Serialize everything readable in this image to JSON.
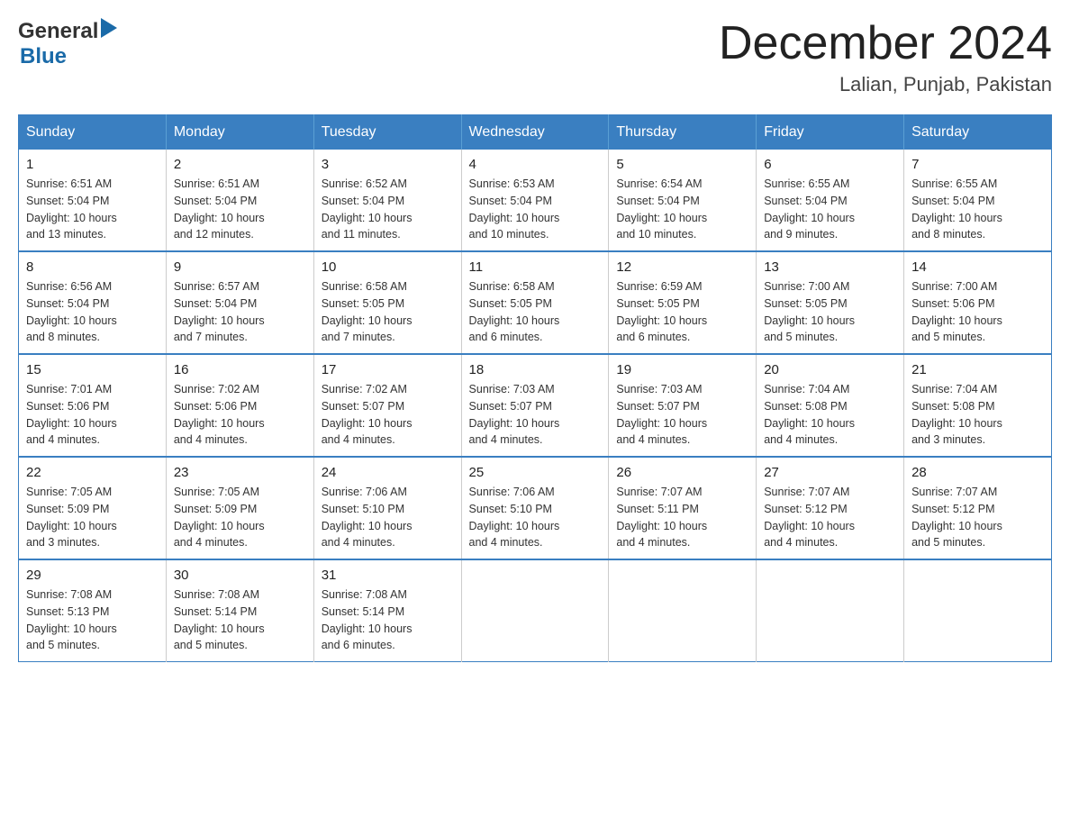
{
  "header": {
    "main_title": "December 2024",
    "subtitle": "Lalian, Punjab, Pakistan",
    "logo_general": "General",
    "logo_blue": "Blue"
  },
  "calendar": {
    "days_of_week": [
      "Sunday",
      "Monday",
      "Tuesday",
      "Wednesday",
      "Thursday",
      "Friday",
      "Saturday"
    ],
    "weeks": [
      [
        {
          "day": "1",
          "sunrise": "6:51 AM",
          "sunset": "5:04 PM",
          "daylight": "10 hours and 13 minutes."
        },
        {
          "day": "2",
          "sunrise": "6:51 AM",
          "sunset": "5:04 PM",
          "daylight": "10 hours and 12 minutes."
        },
        {
          "day": "3",
          "sunrise": "6:52 AM",
          "sunset": "5:04 PM",
          "daylight": "10 hours and 11 minutes."
        },
        {
          "day": "4",
          "sunrise": "6:53 AM",
          "sunset": "5:04 PM",
          "daylight": "10 hours and 10 minutes."
        },
        {
          "day": "5",
          "sunrise": "6:54 AM",
          "sunset": "5:04 PM",
          "daylight": "10 hours and 10 minutes."
        },
        {
          "day": "6",
          "sunrise": "6:55 AM",
          "sunset": "5:04 PM",
          "daylight": "10 hours and 9 minutes."
        },
        {
          "day": "7",
          "sunrise": "6:55 AM",
          "sunset": "5:04 PM",
          "daylight": "10 hours and 8 minutes."
        }
      ],
      [
        {
          "day": "8",
          "sunrise": "6:56 AM",
          "sunset": "5:04 PM",
          "daylight": "10 hours and 8 minutes."
        },
        {
          "day": "9",
          "sunrise": "6:57 AM",
          "sunset": "5:04 PM",
          "daylight": "10 hours and 7 minutes."
        },
        {
          "day": "10",
          "sunrise": "6:58 AM",
          "sunset": "5:05 PM",
          "daylight": "10 hours and 7 minutes."
        },
        {
          "day": "11",
          "sunrise": "6:58 AM",
          "sunset": "5:05 PM",
          "daylight": "10 hours and 6 minutes."
        },
        {
          "day": "12",
          "sunrise": "6:59 AM",
          "sunset": "5:05 PM",
          "daylight": "10 hours and 6 minutes."
        },
        {
          "day": "13",
          "sunrise": "7:00 AM",
          "sunset": "5:05 PM",
          "daylight": "10 hours and 5 minutes."
        },
        {
          "day": "14",
          "sunrise": "7:00 AM",
          "sunset": "5:06 PM",
          "daylight": "10 hours and 5 minutes."
        }
      ],
      [
        {
          "day": "15",
          "sunrise": "7:01 AM",
          "sunset": "5:06 PM",
          "daylight": "10 hours and 4 minutes."
        },
        {
          "day": "16",
          "sunrise": "7:02 AM",
          "sunset": "5:06 PM",
          "daylight": "10 hours and 4 minutes."
        },
        {
          "day": "17",
          "sunrise": "7:02 AM",
          "sunset": "5:07 PM",
          "daylight": "10 hours and 4 minutes."
        },
        {
          "day": "18",
          "sunrise": "7:03 AM",
          "sunset": "5:07 PM",
          "daylight": "10 hours and 4 minutes."
        },
        {
          "day": "19",
          "sunrise": "7:03 AM",
          "sunset": "5:07 PM",
          "daylight": "10 hours and 4 minutes."
        },
        {
          "day": "20",
          "sunrise": "7:04 AM",
          "sunset": "5:08 PM",
          "daylight": "10 hours and 4 minutes."
        },
        {
          "day": "21",
          "sunrise": "7:04 AM",
          "sunset": "5:08 PM",
          "daylight": "10 hours and 3 minutes."
        }
      ],
      [
        {
          "day": "22",
          "sunrise": "7:05 AM",
          "sunset": "5:09 PM",
          "daylight": "10 hours and 3 minutes."
        },
        {
          "day": "23",
          "sunrise": "7:05 AM",
          "sunset": "5:09 PM",
          "daylight": "10 hours and 4 minutes."
        },
        {
          "day": "24",
          "sunrise": "7:06 AM",
          "sunset": "5:10 PM",
          "daylight": "10 hours and 4 minutes."
        },
        {
          "day": "25",
          "sunrise": "7:06 AM",
          "sunset": "5:10 PM",
          "daylight": "10 hours and 4 minutes."
        },
        {
          "day": "26",
          "sunrise": "7:07 AM",
          "sunset": "5:11 PM",
          "daylight": "10 hours and 4 minutes."
        },
        {
          "day": "27",
          "sunrise": "7:07 AM",
          "sunset": "5:12 PM",
          "daylight": "10 hours and 4 minutes."
        },
        {
          "day": "28",
          "sunrise": "7:07 AM",
          "sunset": "5:12 PM",
          "daylight": "10 hours and 5 minutes."
        }
      ],
      [
        {
          "day": "29",
          "sunrise": "7:08 AM",
          "sunset": "5:13 PM",
          "daylight": "10 hours and 5 minutes."
        },
        {
          "day": "30",
          "sunrise": "7:08 AM",
          "sunset": "5:14 PM",
          "daylight": "10 hours and 5 minutes."
        },
        {
          "day": "31",
          "sunrise": "7:08 AM",
          "sunset": "5:14 PM",
          "daylight": "10 hours and 6 minutes."
        },
        null,
        null,
        null,
        null
      ]
    ],
    "labels": {
      "sunrise": "Sunrise:",
      "sunset": "Sunset:",
      "daylight": "Daylight:"
    }
  }
}
